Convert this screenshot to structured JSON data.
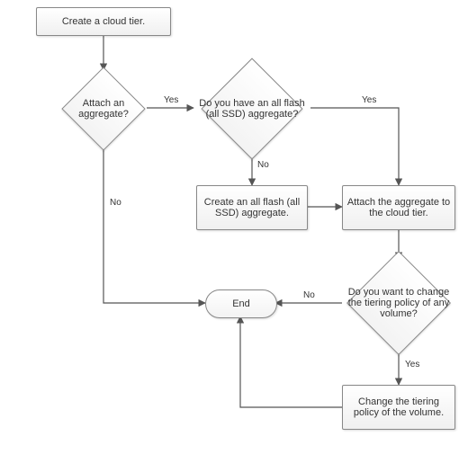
{
  "chart_data": {
    "type": "flowchart",
    "nodes": [
      {
        "id": "create_cloud_tier",
        "kind": "process",
        "label": "Create a cloud tier."
      },
      {
        "id": "attach_aggregate",
        "kind": "decision",
        "label": "Attach an aggregate?"
      },
      {
        "id": "have_all_flash",
        "kind": "decision",
        "label": "Do you have an all flash (all SSD) aggregate?"
      },
      {
        "id": "create_all_flash",
        "kind": "process",
        "label": "Create an all flash (all SSD) aggregate."
      },
      {
        "id": "attach_to_cloud",
        "kind": "process",
        "label": "Attach the aggregate to the cloud tier."
      },
      {
        "id": "change_policy_q",
        "kind": "decision",
        "label": "Do you want to change the tiering policy of any volume?"
      },
      {
        "id": "change_policy",
        "kind": "process",
        "label": "Change the tiering policy of the volume."
      },
      {
        "id": "end",
        "kind": "terminator",
        "label": "End"
      }
    ],
    "edges": [
      {
        "from": "create_cloud_tier",
        "to": "attach_aggregate",
        "label": ""
      },
      {
        "from": "attach_aggregate",
        "to": "have_all_flash",
        "label": "Yes"
      },
      {
        "from": "attach_aggregate",
        "to": "end",
        "label": "No"
      },
      {
        "from": "have_all_flash",
        "to": "attach_to_cloud",
        "label": "Yes"
      },
      {
        "from": "have_all_flash",
        "to": "create_all_flash",
        "label": "No"
      },
      {
        "from": "create_all_flash",
        "to": "attach_to_cloud",
        "label": ""
      },
      {
        "from": "attach_to_cloud",
        "to": "change_policy_q",
        "label": ""
      },
      {
        "from": "change_policy_q",
        "to": "change_policy",
        "label": "Yes"
      },
      {
        "from": "change_policy_q",
        "to": "end",
        "label": "No"
      },
      {
        "from": "change_policy",
        "to": "end",
        "label": ""
      }
    ]
  },
  "labels": {
    "yes": "Yes",
    "no": "No"
  },
  "nodes": {
    "create_cloud_tier": "Create a cloud tier.",
    "attach_aggregate": "Attach an aggregate?",
    "have_all_flash": "Do you have an all flash (all SSD) aggregate?",
    "create_all_flash": "Create an all flash (all SSD) aggregate.",
    "attach_to_cloud": "Attach the aggregate to the cloud tier.",
    "change_policy_q": "Do you want to change the tiering policy of any volume?",
    "change_policy": "Change the tiering policy of the volume.",
    "end": "End"
  }
}
